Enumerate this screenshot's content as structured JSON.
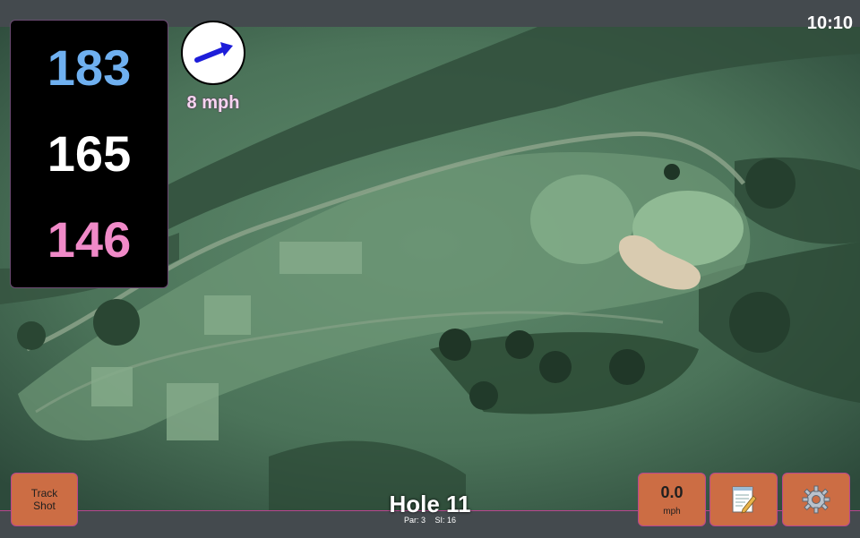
{
  "status": {
    "time": "10:10"
  },
  "distances": {
    "back": "183",
    "middle": "165",
    "front": "146",
    "colors": {
      "back": "#6fb0f0",
      "middle": "#ffffff",
      "front": "#f08ac8"
    }
  },
  "wind": {
    "speed": "8 mph",
    "direction_icon": "arrow-icon",
    "arrow_color": "#1d1dd9"
  },
  "hole": {
    "title": "Hole 11",
    "par": "Par: 3",
    "si": "SI: 16"
  },
  "buttons": {
    "track_shot_line1": "Track",
    "track_shot_line2": "Shot",
    "speed_value": "0.0",
    "speed_unit": "mph",
    "notes_icon": "notepad-icon",
    "settings_icon": "gear-icon"
  },
  "theme": {
    "button_bg": "#cc6d44",
    "accent_border": "#b9468f"
  }
}
